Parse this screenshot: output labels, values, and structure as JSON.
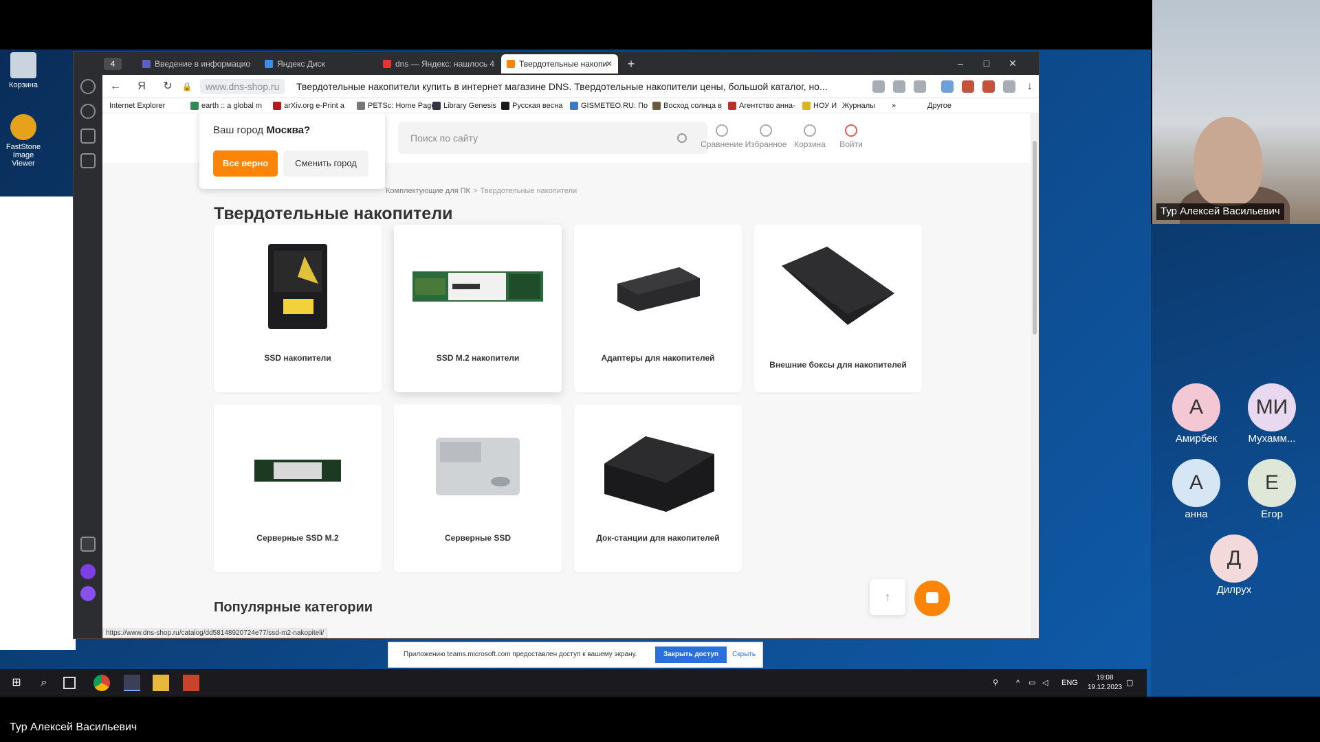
{
  "desktop": {
    "icons": [
      {
        "label": "Корзина",
        "icon": "recycle-bin-icon"
      },
      {
        "label": "FastStone Image Viewer",
        "icon": "faststone-icon"
      }
    ]
  },
  "browser": {
    "tabs": [
      {
        "label": "Введение в информацио",
        "icon": "teams-icon"
      },
      {
        "label": "Яндекс Диск",
        "icon": "disk-icon"
      },
      {
        "label": "dns — Яндекс: нашлось 4",
        "icon": "yandex-icon"
      },
      {
        "label": "Твердотельные накопи",
        "icon": "dns-icon",
        "active": true
      }
    ],
    "tab_count": "4",
    "address_host": "www.dns-shop.ru",
    "page_title": "Твердотельные накопители купить в интернет магазине DNS. Твердотельные накопители цены, большой каталог, но...",
    "bookmarks": [
      "Internet Explorer",
      "earth :: a global m",
      "arXiv.org e-Print a",
      "PETSc: Home Page",
      "Library Genesis",
      "Русская весна",
      "GISMETEO.RU: По",
      "Восход солнца в",
      "Агентство анна-",
      "НОУ И",
      "Журналы",
      "»",
      "Другое"
    ],
    "status_url": "https://www.dns-shop.ru/catalog/dd58148920724e77/ssd-m2-nakopiteli/"
  },
  "site": {
    "city_popup": {
      "question": "Ваш город ",
      "city": "Москва?",
      "confirm": "Все верно",
      "change": "Сменить город"
    },
    "search_placeholder": "Поиск по сайту",
    "header_items": [
      "Сравнение",
      "Избранное",
      "Корзина",
      "Войти"
    ],
    "breadcrumbs": [
      "Комплектующие для ПК",
      "Твердотельные накопители"
    ],
    "title": "Твердотельные накопители",
    "categories": [
      "SSD накопители",
      "SSD M.2 накопители",
      "Адаптеры для накопителей",
      "Внешние боксы для накопителей",
      "Серверные SSD M.2",
      "Серверные SSD",
      "Док-станции для накопителей"
    ],
    "popular_title": "Популярные категории"
  },
  "screen_share": {
    "notice": "Приложению teams.microsoft.com предоставлен доступ к вашему экрану.",
    "stop": "Закрыть доступ",
    "hide": "Скрыть"
  },
  "taskbar": {
    "lang": "ENG",
    "time": "19:08",
    "date": "19.12.2023"
  },
  "teams": {
    "presenter": "Тур Алексей Васильевич",
    "participants": [
      {
        "initials": "А",
        "name": "Амирбек",
        "color": "#f3c8d4"
      },
      {
        "initials": "МИ",
        "name": "Мухамм...",
        "color": "#e8d9f0"
      },
      {
        "initials": "А",
        "name": "анна",
        "color": "#d6e6f5"
      },
      {
        "initials": "Е",
        "name": "Егор",
        "color": "#dfe8d8"
      },
      {
        "initials": "Д",
        "name": "Дилрух",
        "color": "#f3d9d9"
      }
    ],
    "bottom_label": "Тур Алексей Васильевич"
  }
}
